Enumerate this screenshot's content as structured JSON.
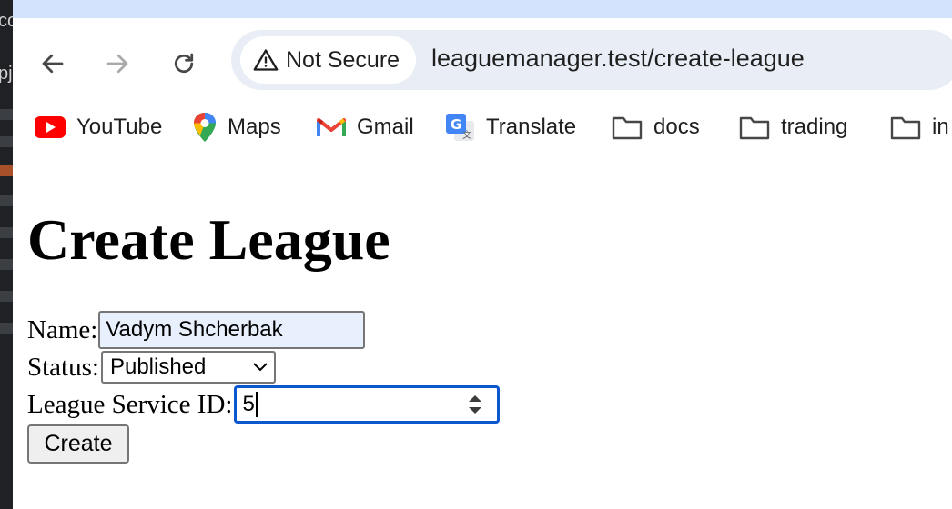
{
  "browser": {
    "security_label": "Not Secure",
    "url": "leaguemanager.test/create-league",
    "bookmarks": [
      {
        "label": "YouTube",
        "icon": "youtube-icon"
      },
      {
        "label": "Maps",
        "icon": "maps-icon"
      },
      {
        "label": "Gmail",
        "icon": "gmail-icon"
      },
      {
        "label": "Translate",
        "icon": "translate-icon"
      },
      {
        "label": "docs",
        "icon": "folder-icon"
      },
      {
        "label": "trading",
        "icon": "folder-icon"
      },
      {
        "label": "in",
        "icon": "folder-icon"
      }
    ]
  },
  "page": {
    "title": "Create League",
    "form": {
      "name_label": "Name:",
      "name_value": "Vadym Shcherbak",
      "status_label": "Status:",
      "status_value": "Published",
      "service_id_label": "League Service ID:",
      "service_id_value": "5",
      "submit_label": "Create"
    }
  },
  "colors": {
    "tab_strip": "#d3e3fd",
    "omnibox": "#e9eef6",
    "autofill_background": "#e8f0fe",
    "focus_ring": "#0b57d0"
  }
}
